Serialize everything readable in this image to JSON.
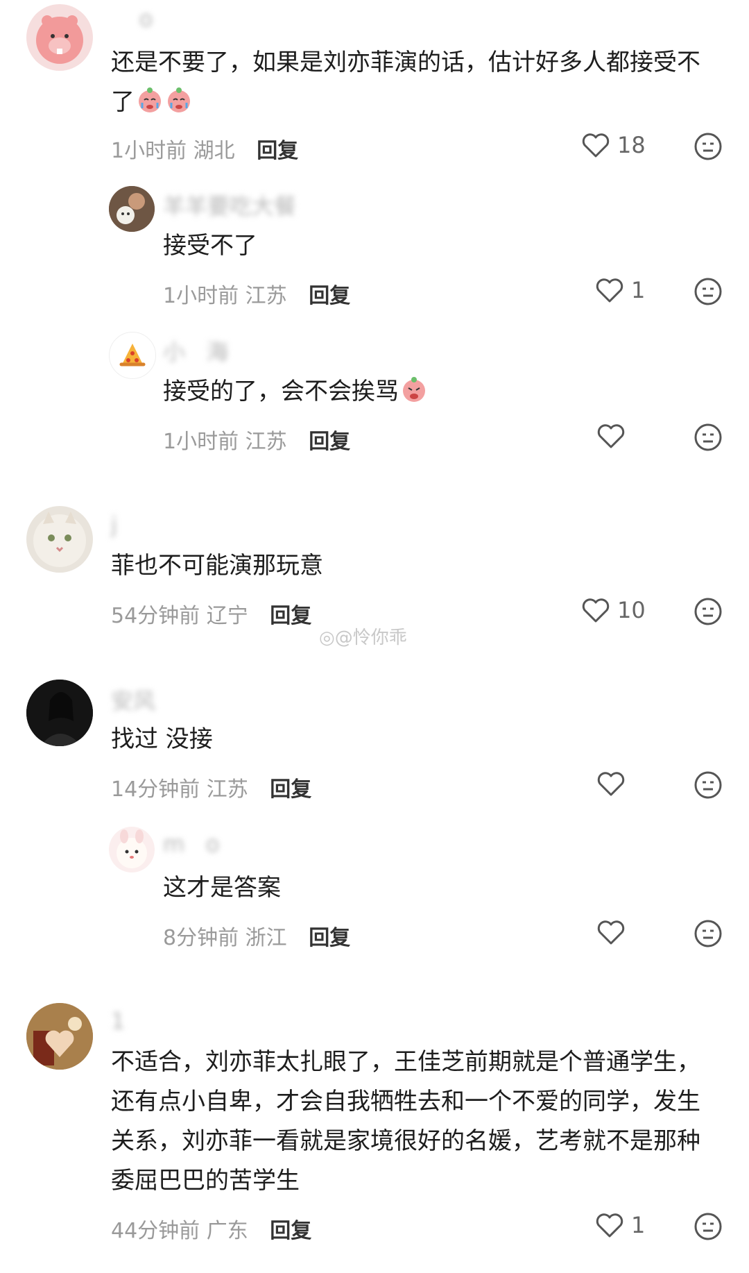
{
  "watermark": "@怜你乖",
  "comments": [
    {
      "username": "    o",
      "text": "还是不要了，如果是刘亦菲演的话，估计好多人都接受不了",
      "time": "1小时前",
      "location": "湖北",
      "reply_label": "回复",
      "likes": "18",
      "avatar_icon": "pink-beaver-avatar"
    },
    {
      "username": "羊羊要吃大餐",
      "text": "接受不了",
      "time": "1小时前",
      "location": "江苏",
      "reply_label": "回复",
      "likes": "1",
      "avatar_icon": "man-with-dog-avatar"
    },
    {
      "username": "小   海",
      "text": "接受的了，会不会挨骂",
      "time": "1小时前",
      "location": "江苏",
      "reply_label": "回复",
      "likes": "",
      "avatar_icon": "pizza-avatar"
    },
    {
      "username": "j  ",
      "text": "菲也不可能演那玩意",
      "time": "54分钟前",
      "location": "辽宁",
      "reply_label": "回复",
      "likes": "10",
      "avatar_icon": "cat-avatar"
    },
    {
      "username": "安风",
      "text": "找过 没接",
      "time": "14分钟前",
      "location": "江苏",
      "reply_label": "回复",
      "likes": "",
      "avatar_icon": "woman-portrait-avatar"
    },
    {
      "username": "m   o",
      "text": "这才是答案",
      "time": "8分钟前",
      "location": "浙江",
      "reply_label": "回复",
      "likes": "",
      "avatar_icon": "cartoon-bunny-avatar"
    },
    {
      "username": "1         ",
      "text": "不适合，刘亦菲太扎眼了，王佳芝前期就是个普通学生，还有点小自卑，才会自我牺牲去和一个不爱的同学，发生关系，刘亦菲一看就是家境很好的名媛，艺考就不是那种委屈巴巴的苦学生",
      "time": "44分钟前",
      "location": "广东",
      "reply_label": "回复",
      "likes": "1",
      "avatar_icon": "heart-hands-avatar"
    }
  ]
}
